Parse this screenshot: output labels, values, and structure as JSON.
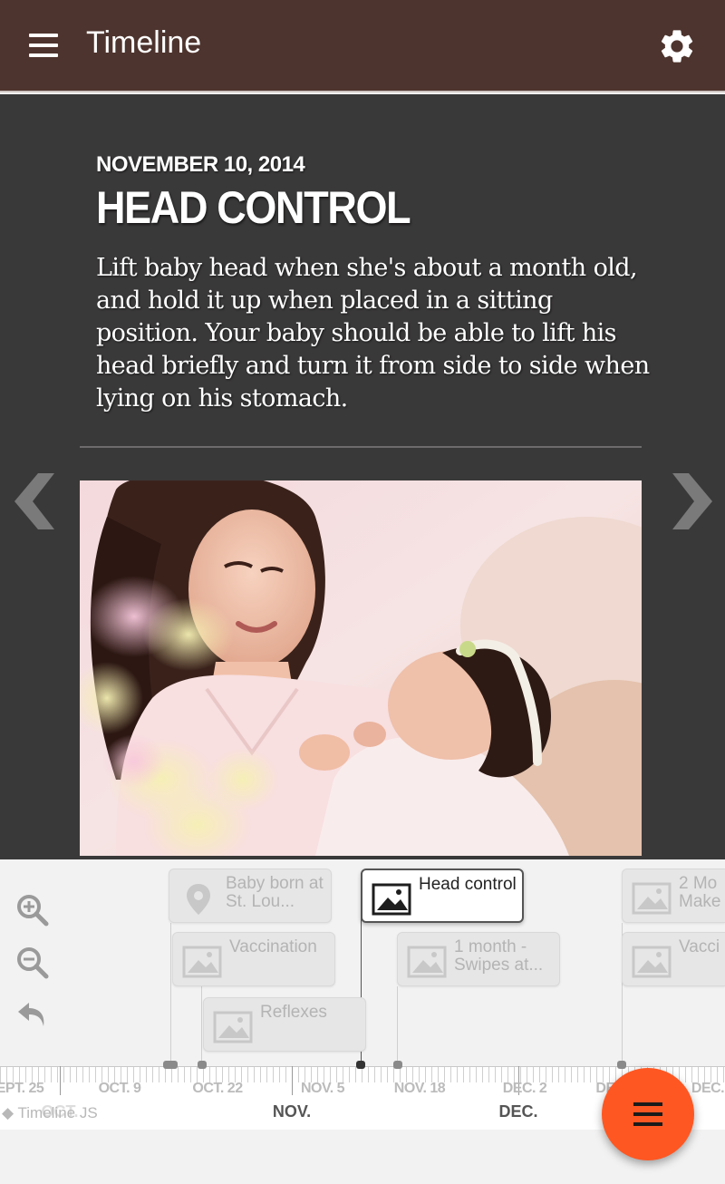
{
  "appbar": {
    "title": "Timeline",
    "color": "#4e342e",
    "menu_icon": "hamburger-icon",
    "settings_icon": "gear-icon"
  },
  "slide": {
    "date": "NOVEMBER 10, 2014",
    "headline": "HEAD CONTROL",
    "text": "Lift baby head when she's about a month old, and hold it up when placed in a sitting position. Your baby should be able to lift his head briefly and turn it from side to side when lying on his stomach.",
    "media_icon": "photo-mother-and-baby",
    "prev_icon": "chevron-left-icon",
    "next_icon": "chevron-right-icon"
  },
  "timenav": {
    "zoom_in_icon": "zoom-in-icon",
    "zoom_out_icon": "zoom-out-icon",
    "back_icon": "undo-icon",
    "markers": [
      {
        "title": "Baby born at St. Lou...",
        "icon": "location-pin-icon",
        "active": false
      },
      {
        "title": "Vaccination",
        "icon": "image-icon",
        "active": false
      },
      {
        "title": "Reflexes",
        "icon": "image-icon",
        "active": false
      },
      {
        "title": "Head control",
        "icon": "image-icon",
        "active": true
      },
      {
        "title": "1 month - Swipes at...",
        "icon": "image-icon",
        "active": false
      },
      {
        "title": "2 Mo Make",
        "icon": "image-icon",
        "active": false
      },
      {
        "title": "Vacci",
        "icon": "image-icon",
        "active": false
      }
    ],
    "ticks": [
      "EPT. 25",
      "OCT. 9",
      "OCT. 22",
      "NOV. 5",
      "NOV. 18",
      "DEC. 2",
      "DE",
      "DEC."
    ],
    "months": [
      "OCT.",
      "NOV.",
      "DEC."
    ],
    "brand": "Timeline JS"
  },
  "fab": {
    "icon": "menu-icon",
    "color": "#ff5722"
  }
}
